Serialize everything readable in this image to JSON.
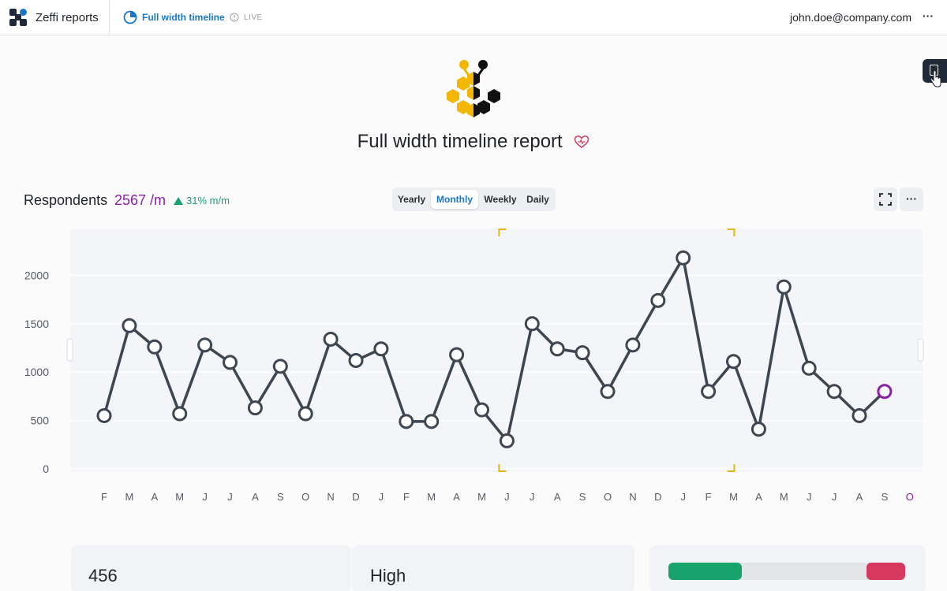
{
  "topbar": {
    "app_name": "Zeffi reports",
    "breadcrumb": "Full width timeline",
    "status": "LIVE",
    "user_email": "john.doe@company.com",
    "more_label": "···"
  },
  "report": {
    "title": "Full width timeline report"
  },
  "metric": {
    "label": "Respondents",
    "value": "2567 /m",
    "trend": "31% m/m"
  },
  "periods": {
    "yearly": "Yearly",
    "monthly": "Monthly",
    "weekly": "Weekly",
    "daily": "Daily",
    "selected": "Monthly"
  },
  "chart_more_label": "···",
  "chart_data": {
    "type": "line",
    "title": "",
    "xlabel": "",
    "ylabel": "",
    "categories": [
      "F",
      "M",
      "A",
      "M",
      "J",
      "J",
      "A",
      "S",
      "O",
      "N",
      "D",
      "J",
      "F",
      "M",
      "A",
      "M",
      "J",
      "J",
      "A",
      "S",
      "O",
      "N",
      "D",
      "J",
      "F",
      "M",
      "A",
      "M",
      "J",
      "J",
      "A",
      "S",
      "O"
    ],
    "series": [
      {
        "values": [
          550,
          1480,
          1260,
          570,
          1280,
          1100,
          630,
          1060,
          570,
          1340,
          1120,
          1240,
          490,
          490,
          1180,
          610,
          290,
          1500,
          1240,
          1200,
          800,
          1280,
          1740,
          2180,
          800,
          1110,
          410,
          1880,
          1040,
          800,
          550,
          800
        ]
      }
    ],
    "y_ticks": [
      0,
      500,
      1000,
      1500,
      2000
    ],
    "ylim": [
      0,
      2500
    ],
    "grid": true,
    "highlight_last_point": true,
    "selection_range": [
      "J",
      "M"
    ]
  },
  "summary": {
    "card1_value": "456",
    "card2_value": "High"
  },
  "colors": {
    "accent_blue": "#1877c9",
    "metric_purple": "#8b1fa9",
    "trend_green": "#17a36b",
    "line": "#3d4651",
    "selection": "#e2b51b",
    "bar_good": "#17a36b",
    "bar_bad": "#d7385e"
  }
}
